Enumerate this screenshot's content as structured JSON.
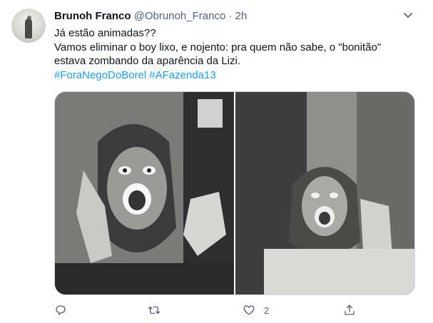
{
  "tweet": {
    "author_name": "Brunoh Franco",
    "author_handle": "@Obrunoh_Franco",
    "separator": "·",
    "time": "2h",
    "text_lines": [
      "Já estão animadas??",
      "Vamos eliminar o boy lixo, e nojento: pra quem não sabe, o \"bonitão\"",
      "estava zombando da aparência da Lizi."
    ],
    "hashtags": [
      "#ForaNegoDoBorel",
      "#AFazenda13"
    ],
    "like_count": "2"
  },
  "icons": {
    "more": "more-chevron-icon",
    "reply": "reply-icon",
    "retweet": "retweet-icon",
    "like": "heart-icon",
    "share": "share-icon"
  },
  "colors": {
    "link": "#1d9bf0",
    "secondary_text": "#536471",
    "primary_text": "#0f1419",
    "border": "#cfd9de"
  }
}
